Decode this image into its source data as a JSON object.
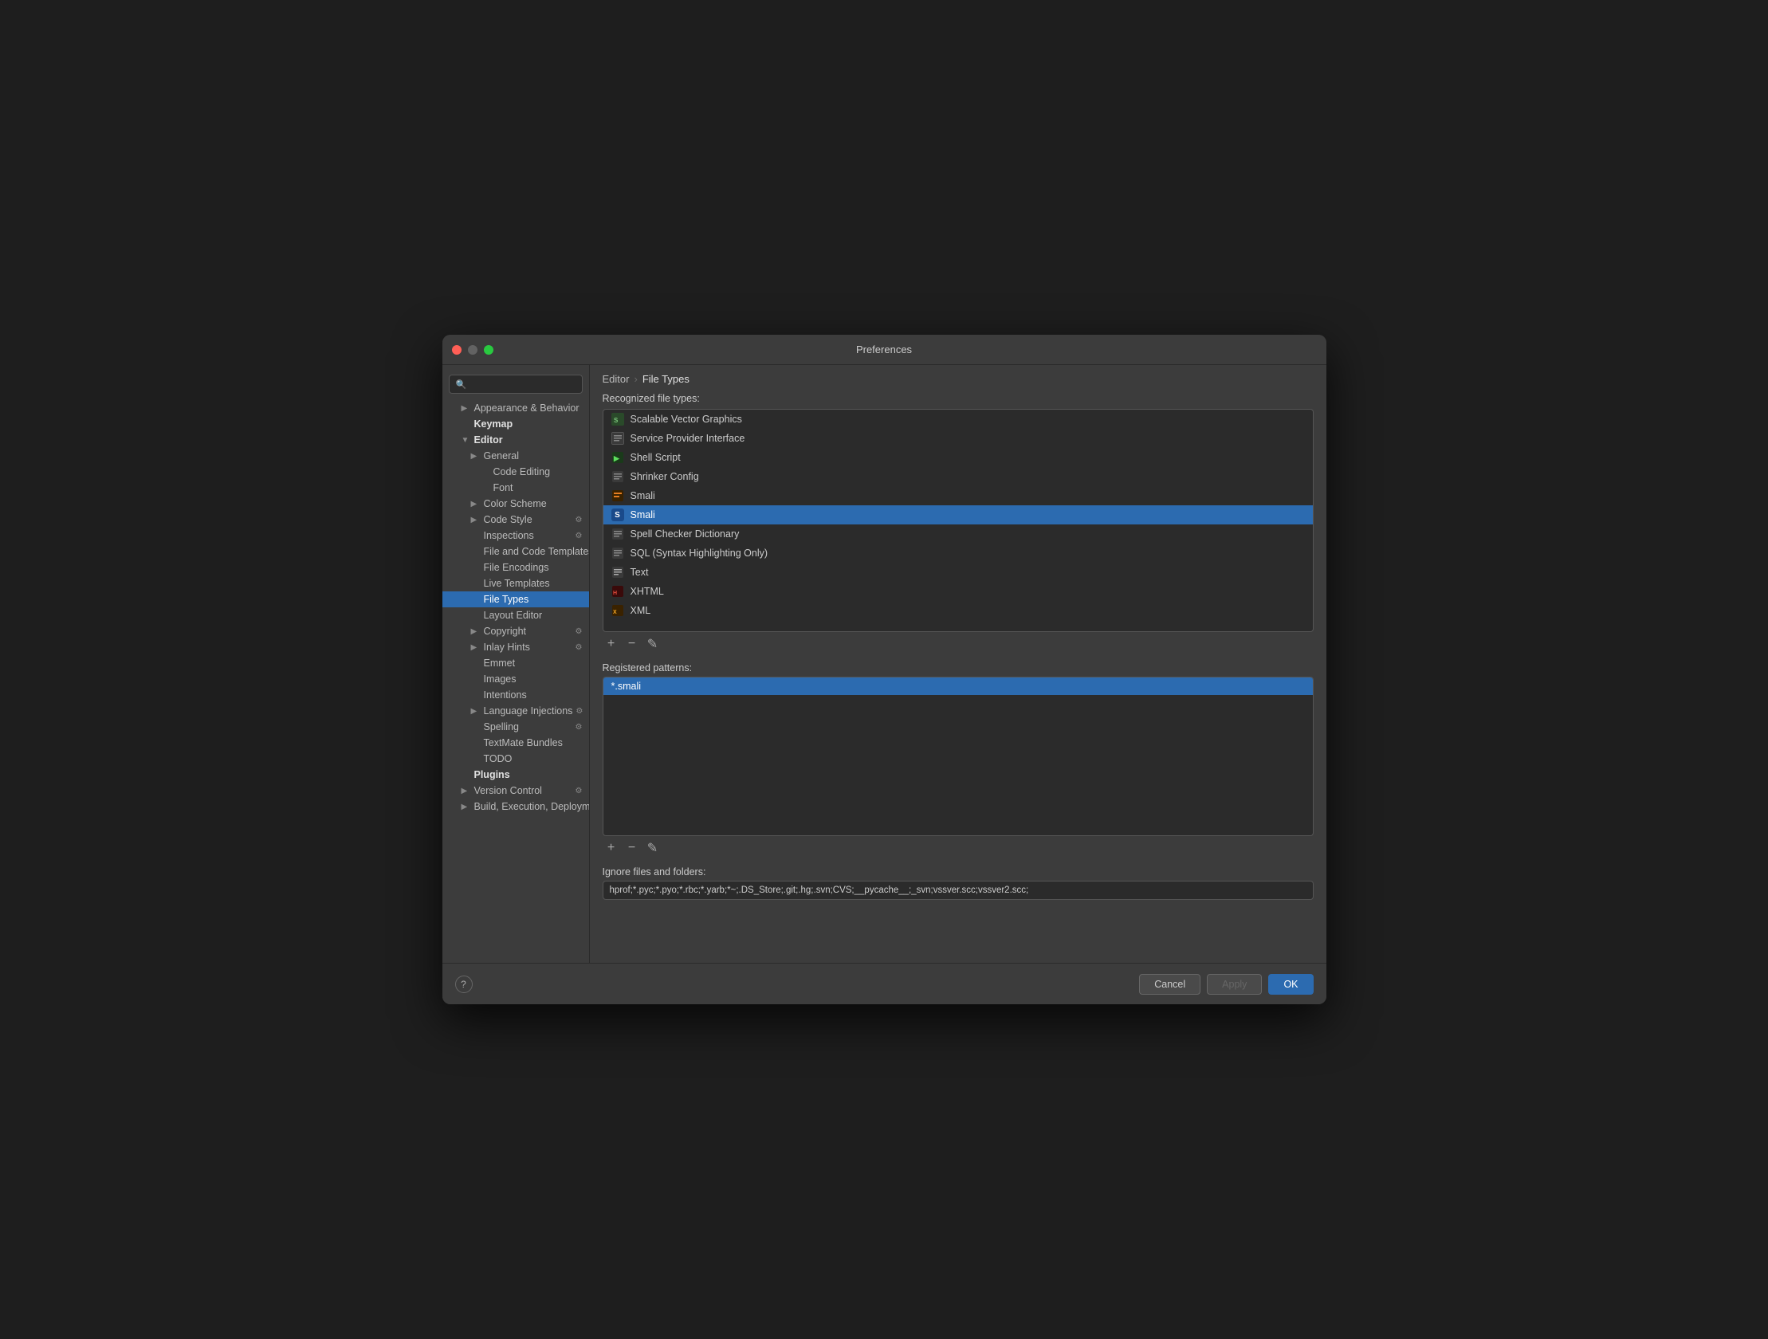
{
  "window": {
    "title": "Preferences"
  },
  "sidebar": {
    "search_placeholder": "🔍",
    "items": [
      {
        "id": "appearance",
        "label": "Appearance & Behavior",
        "indent": 1,
        "arrow": "▶",
        "bold": false
      },
      {
        "id": "keymap",
        "label": "Keymap",
        "indent": 1,
        "arrow": "",
        "bold": true
      },
      {
        "id": "editor",
        "label": "Editor",
        "indent": 1,
        "arrow": "▼",
        "bold": true
      },
      {
        "id": "general",
        "label": "General",
        "indent": 2,
        "arrow": "▶",
        "bold": false
      },
      {
        "id": "code-editing",
        "label": "Code Editing",
        "indent": 3,
        "arrow": "",
        "bold": false
      },
      {
        "id": "font",
        "label": "Font",
        "indent": 3,
        "arrow": "",
        "bold": false
      },
      {
        "id": "color-scheme",
        "label": "Color Scheme",
        "indent": 2,
        "arrow": "▶",
        "bold": false
      },
      {
        "id": "code-style",
        "label": "Code Style",
        "indent": 2,
        "arrow": "▶",
        "bold": false,
        "gear": true
      },
      {
        "id": "inspections",
        "label": "Inspections",
        "indent": 2,
        "arrow": "",
        "bold": false,
        "gear": true
      },
      {
        "id": "file-code-templates",
        "label": "File and Code Templates",
        "indent": 2,
        "arrow": "",
        "bold": false,
        "gear": true
      },
      {
        "id": "file-encodings",
        "label": "File Encodings",
        "indent": 2,
        "arrow": "",
        "bold": false
      },
      {
        "id": "live-templates",
        "label": "Live Templates",
        "indent": 2,
        "arrow": "",
        "bold": false
      },
      {
        "id": "file-types",
        "label": "File Types",
        "indent": 2,
        "arrow": "",
        "bold": false,
        "selected": true
      },
      {
        "id": "layout-editor",
        "label": "Layout Editor",
        "indent": 2,
        "arrow": "",
        "bold": false
      },
      {
        "id": "copyright",
        "label": "Copyright",
        "indent": 2,
        "arrow": "▶",
        "bold": false,
        "gear": true
      },
      {
        "id": "inlay-hints",
        "label": "Inlay Hints",
        "indent": 2,
        "arrow": "▶",
        "bold": false,
        "gear": true
      },
      {
        "id": "emmet",
        "label": "Emmet",
        "indent": 2,
        "arrow": "",
        "bold": false
      },
      {
        "id": "images",
        "label": "Images",
        "indent": 2,
        "arrow": "",
        "bold": false
      },
      {
        "id": "intentions",
        "label": "Intentions",
        "indent": 2,
        "arrow": "",
        "bold": false
      },
      {
        "id": "language-injections",
        "label": "Language Injections",
        "indent": 2,
        "arrow": "▶",
        "bold": false,
        "gear": true
      },
      {
        "id": "spelling",
        "label": "Spelling",
        "indent": 2,
        "arrow": "",
        "bold": false,
        "gear": true
      },
      {
        "id": "textmate-bundles",
        "label": "TextMate Bundles",
        "indent": 2,
        "arrow": "",
        "bold": false
      },
      {
        "id": "todo",
        "label": "TODO",
        "indent": 2,
        "arrow": "",
        "bold": false
      },
      {
        "id": "plugins",
        "label": "Plugins",
        "indent": 1,
        "arrow": "",
        "bold": true
      },
      {
        "id": "version-control",
        "label": "Version Control",
        "indent": 1,
        "arrow": "▶",
        "bold": false,
        "gear": true
      },
      {
        "id": "build-exec-deploy",
        "label": "Build, Execution, Deployment",
        "indent": 1,
        "arrow": "▶",
        "bold": false
      }
    ]
  },
  "breadcrumb": {
    "parent": "Editor",
    "separator": "›",
    "current": "File Types"
  },
  "recognized_label": "Recognized file types:",
  "file_types": [
    {
      "id": "svg",
      "label": "Scalable Vector Graphics",
      "icon_type": "svg-file",
      "icon_color": "#f5a623"
    },
    {
      "id": "spi",
      "label": "Service Provider Interface",
      "icon_type": "generic",
      "icon_color": "#888"
    },
    {
      "id": "shell",
      "label": "Shell Script",
      "icon_type": "shell",
      "icon_color": "#888"
    },
    {
      "id": "shrinker",
      "label": "Shrinker Config",
      "icon_type": "config",
      "icon_color": "#888"
    },
    {
      "id": "smali1",
      "label": "Smali",
      "icon_type": "smali",
      "icon_color": "#e67e22"
    },
    {
      "id": "smali2",
      "label": "Smali",
      "icon_type": "smali-s",
      "icon_color": "#e67e22",
      "selected": true
    },
    {
      "id": "spell",
      "label": "Spell Checker Dictionary",
      "icon_type": "dict",
      "icon_color": "#888"
    },
    {
      "id": "sql",
      "label": "SQL (Syntax Highlighting Only)",
      "icon_type": "sql",
      "icon_color": "#888"
    },
    {
      "id": "text",
      "label": "Text",
      "icon_type": "text",
      "icon_color": "#888"
    },
    {
      "id": "xhtml",
      "label": "XHTML",
      "icon_type": "html",
      "icon_color": "#e74c3c"
    },
    {
      "id": "xml",
      "label": "XML",
      "icon_type": "xml",
      "icon_color": "#f5a623"
    }
  ],
  "toolbar": {
    "add": "+",
    "remove": "−",
    "edit": "✎"
  },
  "registered_label": "Registered patterns:",
  "patterns": [
    {
      "label": "*.smali",
      "selected": true
    }
  ],
  "pattern_toolbar": {
    "add": "+",
    "remove": "−",
    "edit": "✎"
  },
  "ignore_label": "Ignore files and folders:",
  "ignore_value": "hprof;*.pyc;*.pyo;*.rbc;*.yarb;*~;.DS_Store;.git;.hg;.svn;CVS;__pycache__;_svn;vssver.scc;vssver2.scc;",
  "buttons": {
    "cancel": "Cancel",
    "apply": "Apply",
    "ok": "OK"
  }
}
